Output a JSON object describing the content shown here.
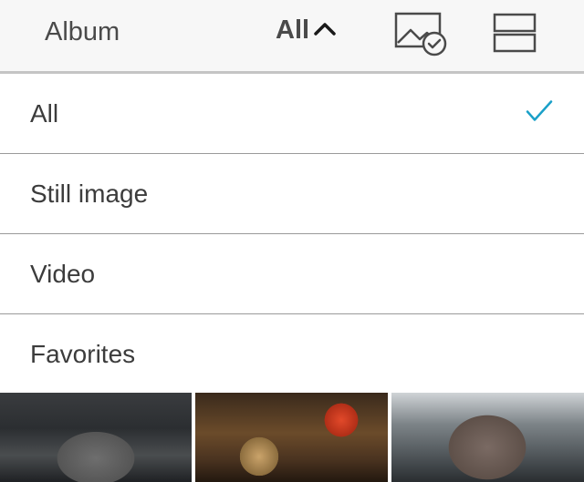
{
  "header": {
    "title": "Album",
    "filter_label": "All",
    "icons": {
      "filter": "chevron-up-icon",
      "select": "image-select-icon",
      "layout": "layout-rows-icon"
    }
  },
  "menu": {
    "items": [
      {
        "label": "All",
        "selected": true
      },
      {
        "label": "Still image",
        "selected": false
      },
      {
        "label": "Video",
        "selected": false
      },
      {
        "label": "Favorites",
        "selected": false
      }
    ],
    "check_color": "#1aa0c8"
  },
  "thumbnails": [
    {
      "kind": "360-photo"
    },
    {
      "kind": "360-photo"
    },
    {
      "kind": "360-photo"
    }
  ]
}
